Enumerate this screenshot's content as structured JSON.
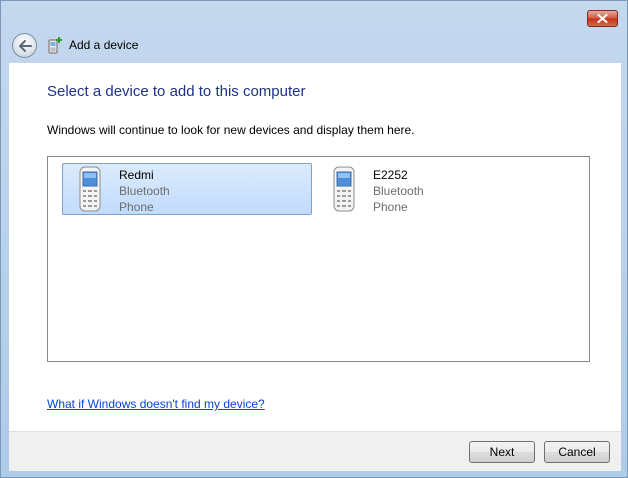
{
  "window": {
    "title": "Add a device",
    "close_icon": "close-icon",
    "back_icon": "back-arrow-icon"
  },
  "main": {
    "heading": "Select a device to add to this computer",
    "description": "Windows will continue to look for new devices and display them here.",
    "devices": [
      {
        "name": "Redmi",
        "connection": "Bluetooth",
        "category": "Phone",
        "icon": "mobile-phone-icon",
        "selected": true
      },
      {
        "name": "E2252",
        "connection": "Bluetooth",
        "category": "Phone",
        "icon": "mobile-phone-icon",
        "selected": false
      }
    ],
    "help_link": "What if Windows doesn't find my device?"
  },
  "footer": {
    "next_label": "Next",
    "cancel_label": "Cancel"
  },
  "colors": {
    "heading": "#1e3287",
    "link": "#0046d5",
    "selection": "#c1dbfc"
  }
}
